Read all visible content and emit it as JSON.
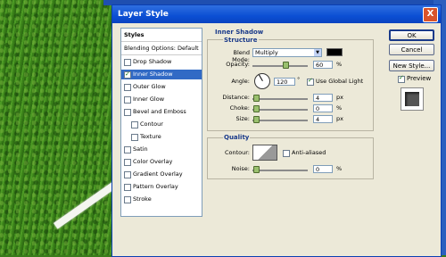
{
  "window": {
    "title": "Layer Style",
    "close_glyph": "X"
  },
  "sidebar": {
    "styles_label": "Styles",
    "blending_label": "Blending Options: Default",
    "items": [
      {
        "label": "Drop Shadow",
        "checked": false
      },
      {
        "label": "Inner Shadow",
        "checked": true,
        "selected": true
      },
      {
        "label": "Outer Glow",
        "checked": false
      },
      {
        "label": "Inner Glow",
        "checked": false
      },
      {
        "label": "Bevel and Emboss",
        "checked": false
      },
      {
        "label": "Contour",
        "checked": false,
        "sub": true
      },
      {
        "label": "Texture",
        "checked": false,
        "sub": true
      },
      {
        "label": "Satin",
        "checked": false
      },
      {
        "label": "Color Overlay",
        "checked": false
      },
      {
        "label": "Gradient Overlay",
        "checked": false
      },
      {
        "label": "Pattern Overlay",
        "checked": false
      },
      {
        "label": "Stroke",
        "checked": false
      }
    ]
  },
  "panel": {
    "title": "Inner Shadow",
    "structure": {
      "legend": "Structure",
      "blend_mode_label": "Blend Mode:",
      "blend_mode_value": "Multiply",
      "shadow_color": "#000000",
      "opacity_label": "Opacity:",
      "opacity_value": "60",
      "opacity_unit": "%",
      "opacity_fraction": 0.6,
      "angle_label": "Angle:",
      "angle_value": "120",
      "angle_unit": "°",
      "global_light_label": "Use Global Light",
      "global_light_checked": true,
      "distance_label": "Distance:",
      "distance_value": "4",
      "distance_unit": "px",
      "choke_label": "Choke:",
      "choke_value": "0",
      "choke_unit": "%",
      "size_label": "Size:",
      "size_value": "4",
      "size_unit": "px"
    },
    "quality": {
      "legend": "Quality",
      "contour_label": "Contour:",
      "anti_aliased_label": "Anti-aliased",
      "anti_aliased_checked": false,
      "noise_label": "Noise:",
      "noise_value": "0",
      "noise_unit": "%"
    }
  },
  "buttons": {
    "ok": "OK",
    "cancel": "Cancel",
    "new_style": "New Style...",
    "preview_label": "Preview",
    "preview_checked": true
  }
}
